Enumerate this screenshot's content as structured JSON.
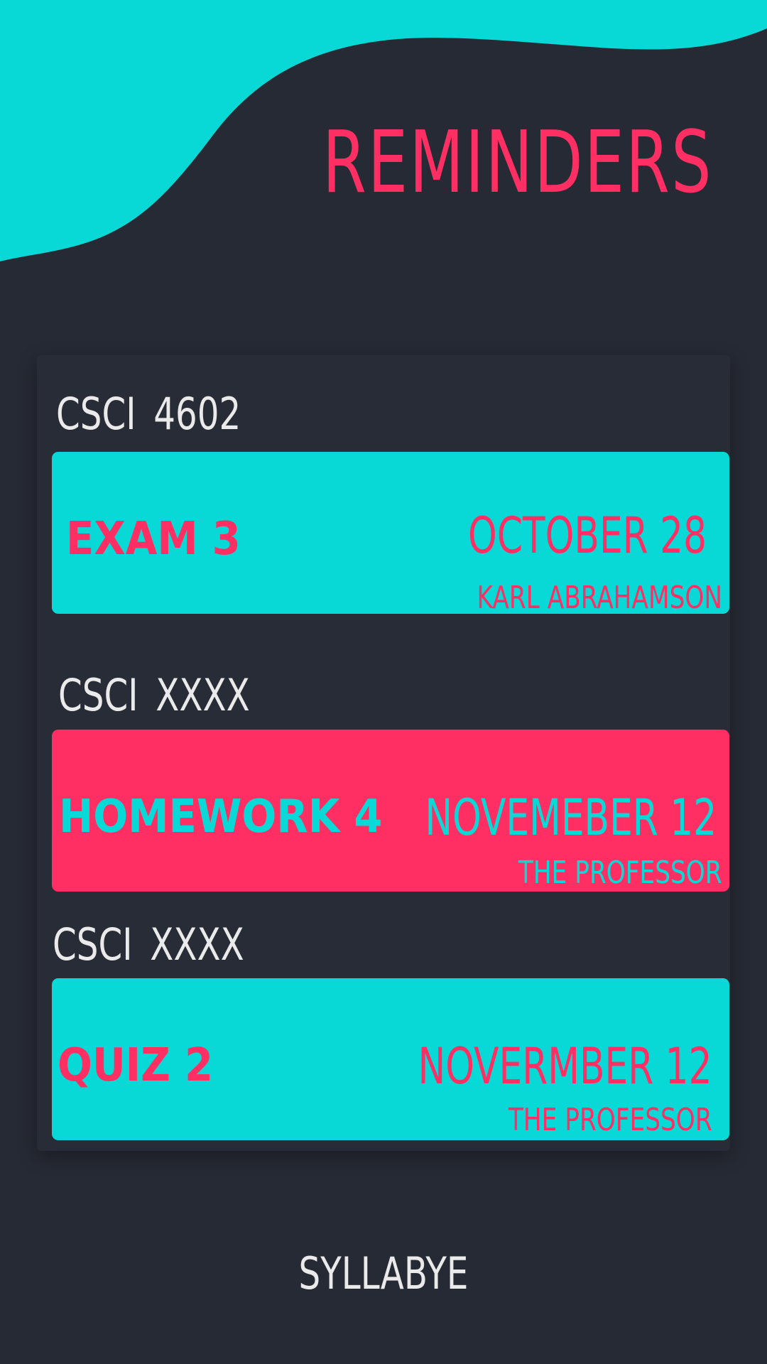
{
  "header": {
    "title": "REMINDERS"
  },
  "reminders": [
    {
      "course": "CSCI 4602",
      "task": "EXAM 3",
      "date": "OCTOBER 28",
      "professor": "KARL ABRAHAMSON"
    },
    {
      "course": "CSCI  XXXX",
      "task": "HOMEWORK 4",
      "date": "NOVEMEBER 12",
      "professor": "THE PROFESSOR"
    },
    {
      "course": "CSCI  XXXX",
      "task": "QUIZ 2",
      "date": "NOVERMBER 12",
      "professor": "THE PROFESSOR"
    }
  ],
  "footer": {
    "brand": "SYLLABYE"
  },
  "colors": {
    "background": "#262a34",
    "panel": "#282c36",
    "accent_cyan": "#08d9d6",
    "accent_pink": "#ff2e63",
    "text_light": "#eaeaea"
  }
}
